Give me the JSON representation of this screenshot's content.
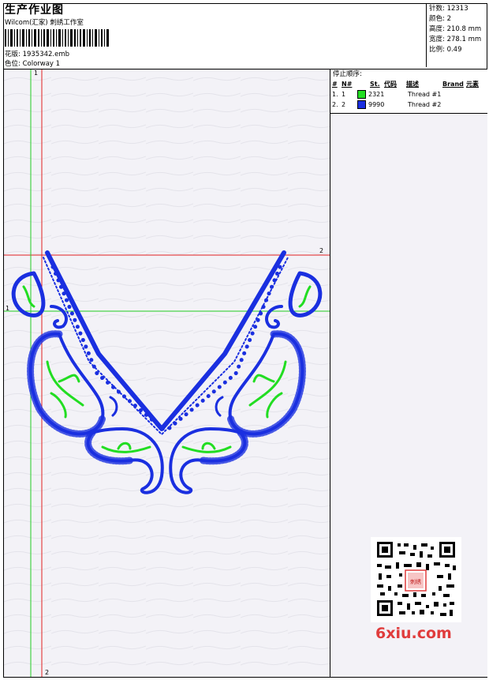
{
  "header": {
    "title": "生产作业图",
    "studio": "Wilcom(汇家) 刺绣工作室",
    "design_label": "花版: 1935342.emb",
    "colorway_label": "色位: Colorway 1"
  },
  "stats": {
    "stitches": "针数: 12313",
    "colors": "颜色: 2",
    "height": "高度: 210.8 mm",
    "width": "宽度: 278.1 mm",
    "scale": "比例: 0.49"
  },
  "stop_sequence": {
    "title": "停止顺序:",
    "columns": [
      "#",
      "N#",
      "St.",
      "代码",
      "描述",
      "Brand",
      "元素"
    ],
    "rows": [
      {
        "num": "1.",
        "needle": "1",
        "color": "#22dd22",
        "code": "2321",
        "desc": "Thread #1"
      },
      {
        "num": "2.",
        "needle": "2",
        "color": "#1a2fe0",
        "code": "9990",
        "desc": "Thread #2"
      }
    ]
  },
  "guides": {
    "v_red": "2",
    "h_red": "2",
    "v_green": "1",
    "h_green": "1"
  },
  "watermark": {
    "text": "6xiu.com",
    "seal": "刺绣图库"
  },
  "colors": {
    "thread1": "#22dd22",
    "thread2": "#1a2fe0",
    "guide_red": "#e02020",
    "guide_green": "#22cc22"
  }
}
